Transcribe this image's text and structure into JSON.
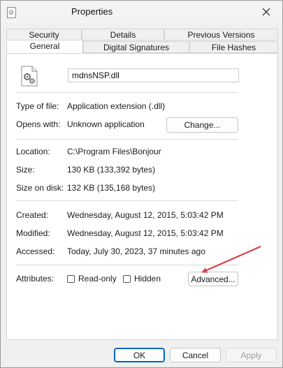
{
  "window": {
    "title": "Properties"
  },
  "tabs": {
    "row_back": [
      "Security",
      "Details",
      "Previous Versions"
    ],
    "row_front": [
      "General",
      "Digital Signatures",
      "File Hashes"
    ],
    "active": "General"
  },
  "file": {
    "name": "mdnsNSP.dll"
  },
  "info": {
    "type_label": "Type of file:",
    "type_value": "Application extension (.dll)",
    "opens_label": "Opens with:",
    "opens_value": "Unknown application",
    "change_button": "Change..."
  },
  "location": {
    "location_label": "Location:",
    "location_value": "C:\\Program Files\\Bonjour",
    "size_label": "Size:",
    "size_value": "130 KB (133,392 bytes)",
    "disk_label": "Size on disk:",
    "disk_value": "132 KB (135,168 bytes)"
  },
  "dates": {
    "created_label": "Created:",
    "created_value": "Wednesday, August 12, 2015, 5:03:42 PM",
    "modified_label": "Modified:",
    "modified_value": "Wednesday, August 12, 2015, 5:03:42 PM",
    "accessed_label": "Accessed:",
    "accessed_value": "Today, July 30, 2023, 37 minutes ago"
  },
  "attributes": {
    "label": "Attributes:",
    "readonly_label": "Read-only",
    "readonly_checked": false,
    "hidden_label": "Hidden",
    "hidden_checked": false,
    "advanced_button": "Advanced..."
  },
  "footer": {
    "ok": "OK",
    "cancel": "Cancel",
    "apply": "Apply"
  },
  "colors": {
    "annotation_arrow": "#d9414b",
    "accent": "#0067c0"
  },
  "icons": {
    "title": "dll-file-icon",
    "close": "close-icon",
    "file": "dll-gear-file-icon"
  }
}
